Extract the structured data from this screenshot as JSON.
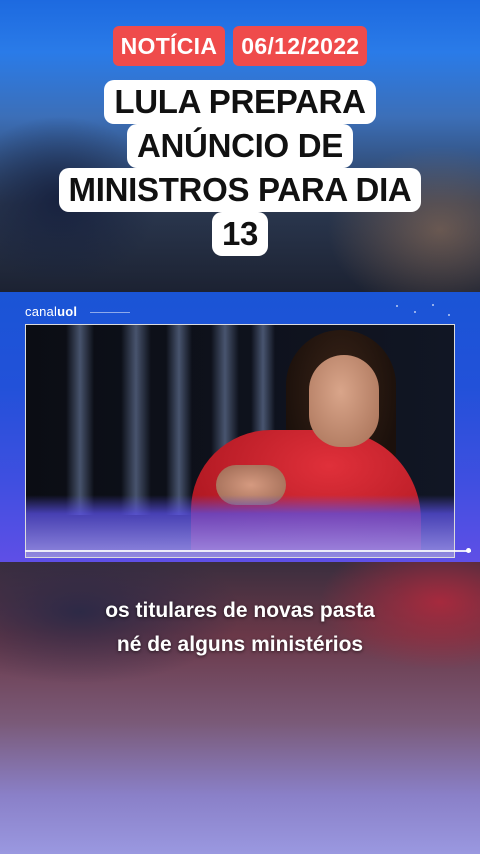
{
  "tags": {
    "category": "NOTÍCIA",
    "date": "06/12/2022"
  },
  "headline": {
    "lines": [
      "LULA PREPARA",
      "ANÚNCIO DE",
      "MINISTROS PARA DIA",
      "13"
    ]
  },
  "video": {
    "brand_prefix": "canal",
    "brand_name": "uol",
    "progress_fraction": 1.0
  },
  "caption": {
    "lines": [
      "os titulares de novas pasta",
      "né de alguns ministérios"
    ]
  },
  "colors": {
    "tag_bg": "#ef4b4b",
    "panel_blue": "#2251d9"
  }
}
